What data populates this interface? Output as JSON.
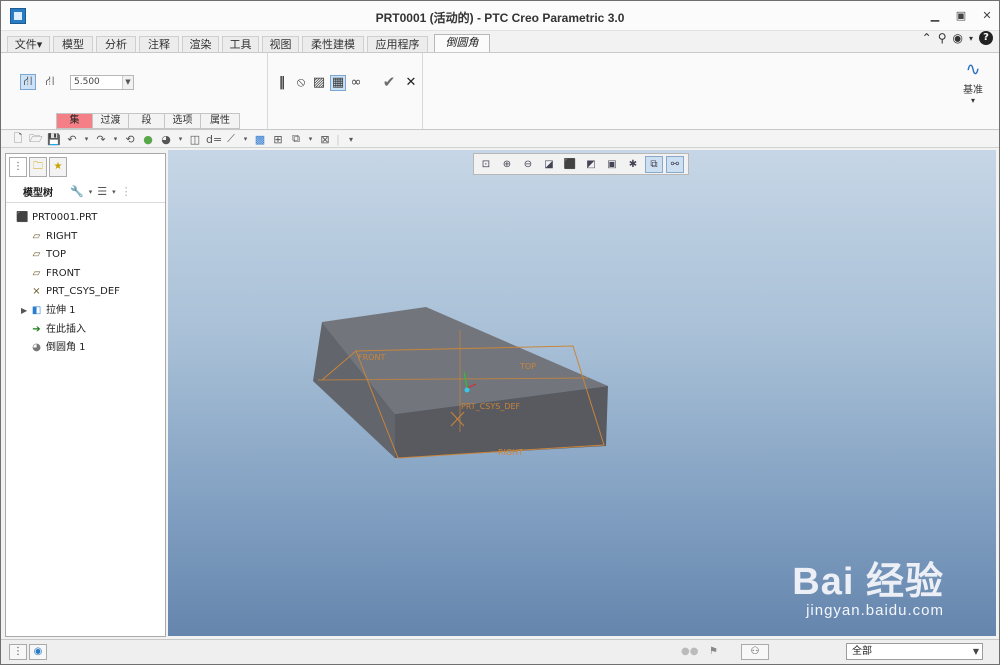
{
  "window": {
    "title": "PRT0001 (活动的) - PTC Creo Parametric 3.0",
    "controls": [
      "minimize",
      "maximize",
      "close"
    ]
  },
  "tabs": [
    {
      "label": "文件",
      "dropdown": "▾"
    },
    {
      "label": "模型"
    },
    {
      "label": "分析"
    },
    {
      "label": "注释"
    },
    {
      "label": "渲染"
    },
    {
      "label": "工具"
    },
    {
      "label": "视图"
    },
    {
      "label": "柔性建模"
    },
    {
      "label": "应用程序"
    },
    {
      "label": "倒圆角",
      "active": true
    }
  ],
  "ribbon": {
    "radius_value": "5.500",
    "subtabs": [
      "集",
      "过渡",
      "段",
      "选项",
      "属性"
    ],
    "datum_label": "基准",
    "datum_more": "▾"
  },
  "model_tree": {
    "header": "模型树",
    "nodes": [
      {
        "label": "PRT0001.PRT",
        "icon": "part-icon"
      },
      {
        "label": "RIGHT",
        "icon": "datum-plane-icon"
      },
      {
        "label": "TOP",
        "icon": "datum-plane-icon"
      },
      {
        "label": "FRONT",
        "icon": "datum-plane-icon"
      },
      {
        "label": "PRT_CSYS_DEF",
        "icon": "csys-icon"
      },
      {
        "label": "拉伸 1",
        "icon": "extrude-icon"
      },
      {
        "label": "在此插入",
        "icon": "insert-arrow-icon"
      },
      {
        "label": "倒圆角 1",
        "icon": "round-icon"
      }
    ]
  },
  "viewport": {
    "plane_labels": {
      "front": "FRONT",
      "top": "TOP",
      "right": "RIGHT",
      "csys": "PRT_CSYS_DEF"
    }
  },
  "watermark": {
    "brand": "Bai 经验",
    "url": "jingyan.baidu.com"
  },
  "statusbar": {
    "filter": "全部"
  },
  "colors": {
    "accent": "#2b7bc4",
    "active_subtab": "#f47f86",
    "model_face": "#6f7278",
    "datum_orange": "#c9853a"
  }
}
